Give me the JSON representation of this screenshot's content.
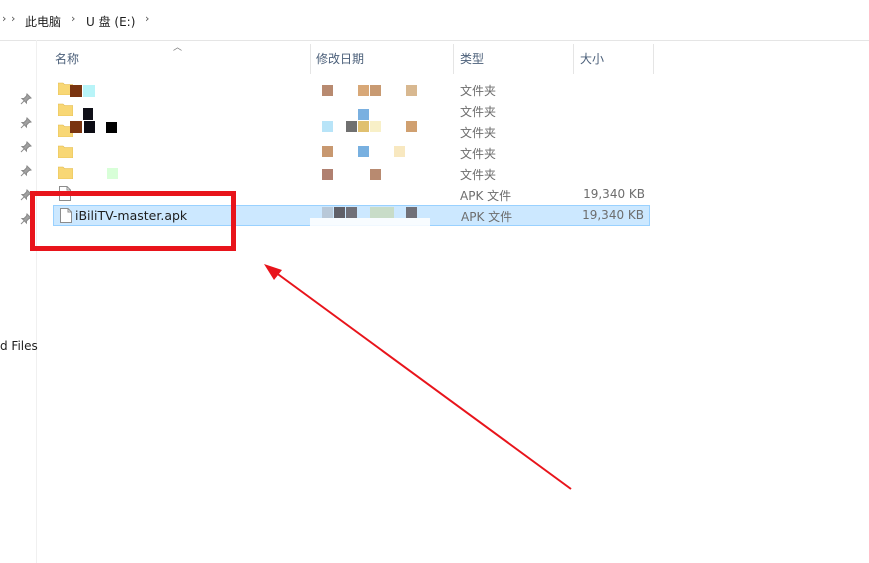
{
  "breadcrumb": {
    "items": [
      "此电脑",
      "U 盘 (E:)"
    ]
  },
  "nav": {
    "partial_label": "d Files"
  },
  "columns": {
    "name": "名称",
    "date": "修改日期",
    "type": "类型",
    "size": "大小"
  },
  "rows": [
    {
      "kind": "folder",
      "name": "",
      "type": "文件夹",
      "size": ""
    },
    {
      "kind": "folder",
      "name": "",
      "type": "文件夹",
      "size": ""
    },
    {
      "kind": "folder",
      "name": "",
      "type": "文件夹",
      "size": ""
    },
    {
      "kind": "folder",
      "name": "",
      "type": "文件夹",
      "size": ""
    },
    {
      "kind": "folder",
      "name": "",
      "type": "文件夹",
      "size": ""
    },
    {
      "kind": "file",
      "name": "",
      "type": "APK 文件",
      "size": "19,340 KB"
    },
    {
      "kind": "file",
      "name": "iBiliTV-master.apk",
      "type": "APK 文件",
      "size": "19,340 KB",
      "selected": true
    }
  ],
  "colors": {
    "selection_bg": "#cce8ff",
    "selection_border": "#99d1ff",
    "annotation_red": "#e8141b",
    "folder_yellow": "#f8d775"
  },
  "icons": {
    "folder": "folder-icon",
    "file": "file-icon",
    "pin": "pin-icon",
    "chevron": "chevron-right-icon"
  }
}
